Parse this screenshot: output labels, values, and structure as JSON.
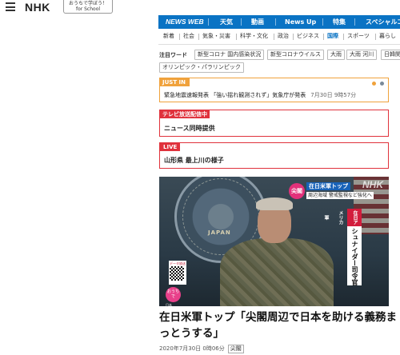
{
  "header": {
    "logo": "NHK",
    "school_line1": "おうちで学ぼう！",
    "school_line2": "for School"
  },
  "main_nav": {
    "items": [
      {
        "label": "NEWS WEB"
      },
      {
        "label": "天気"
      },
      {
        "label": "動画"
      },
      {
        "label": "News Up"
      },
      {
        "label": "特集"
      },
      {
        "label": "スペシャルコ"
      }
    ]
  },
  "sub_nav": {
    "items": [
      {
        "label": "新着"
      },
      {
        "label": "社会"
      },
      {
        "label": "気象・災害"
      },
      {
        "label": "科学・文化"
      },
      {
        "label": "政治"
      },
      {
        "label": "ビジネス"
      },
      {
        "label": "国際"
      },
      {
        "label": "スポーツ"
      },
      {
        "label": "暮らし"
      }
    ],
    "active": "国際"
  },
  "trending": {
    "label": "注目ワード",
    "tags": [
      "新型コロナ 国内感染状況",
      "新型コロナウイルス",
      "大雨",
      "大雨 河川",
      "日韓関",
      "オリンピック・パラリンピック"
    ]
  },
  "just_in": {
    "header": "JUST IN",
    "text": "緊急地震速報発表 「強い揺れ観測されず」気象庁が発表",
    "time": "7月30日 9時57分",
    "dot_colors": [
      "#f0a23c",
      "#7a8a99"
    ]
  },
  "tv_broadcast": {
    "header": "テレビ放送配信中",
    "text": "ニュース同時提供"
  },
  "live": {
    "header": "LIVE",
    "text": "山形県 最上川の様子"
  },
  "video": {
    "watermark": "NHK",
    "seal_text": "JAPAN",
    "caption_badge": "尖閣",
    "caption_line1": "在日米軍トップ",
    "caption_line2": "周辺海域 警戒監視など強化へ",
    "side_label": "在日アメリカ軍",
    "side_name": "シュナイダー司令官",
    "qr_label": "データ放送",
    "pink_badge": "おうち で",
    "pink_text": "日本"
  },
  "article": {
    "headline": "在日米軍トップ「尖閣周辺で日本を助ける義務まっとうする」",
    "date": "2020年7月30日 0時06分",
    "tag": "尖閣"
  },
  "colors": {
    "nav_blue": "#0a73c4",
    "orange": "#f0a23c",
    "red": "#e0323c"
  }
}
